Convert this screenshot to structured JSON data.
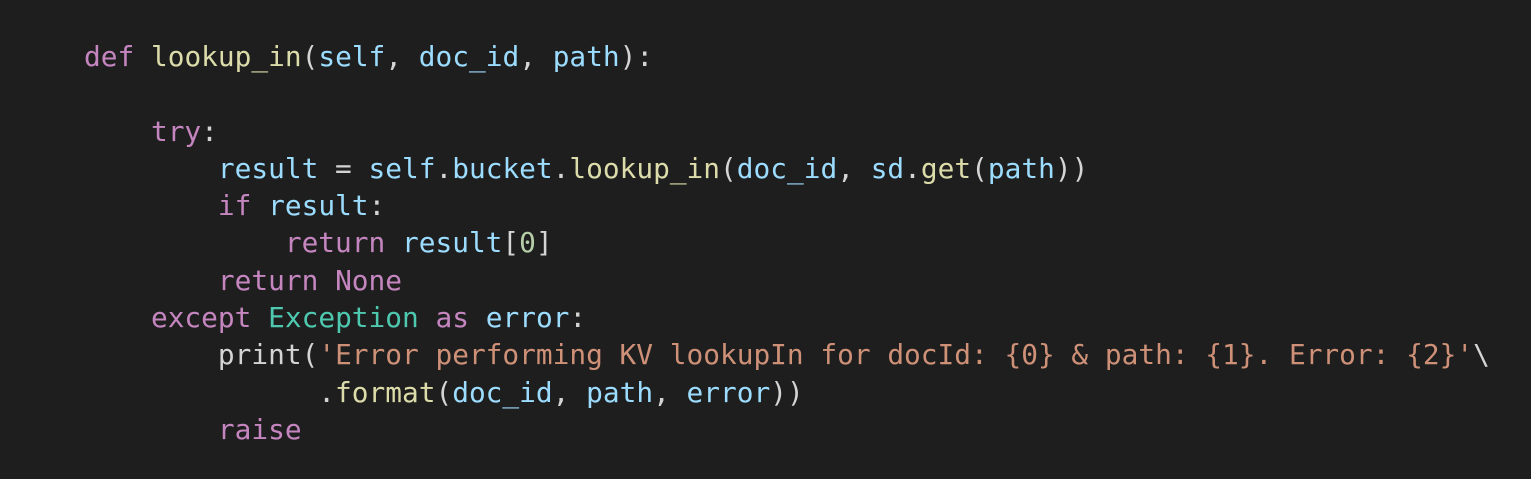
{
  "colors": {
    "background": "#1e1e1e",
    "keyword": "#c586c0",
    "function": "#dcdcaa",
    "variable": "#9cdcfe",
    "class": "#4ec9b0",
    "string": "#ce9178",
    "number": "#b5cea8",
    "plain": "#d4d4d4"
  },
  "code": {
    "language": "python",
    "lines": [
      [
        [
          "keyword",
          "def"
        ],
        [
          "plain",
          " "
        ],
        [
          "function",
          "lookup_in"
        ],
        [
          "plain",
          "("
        ],
        [
          "variable",
          "self"
        ],
        [
          "plain",
          ", "
        ],
        [
          "variable",
          "doc_id"
        ],
        [
          "plain",
          ", "
        ],
        [
          "variable",
          "path"
        ],
        [
          "plain",
          "):"
        ]
      ],
      [],
      [
        [
          "plain",
          "    "
        ],
        [
          "keyword",
          "try"
        ],
        [
          "plain",
          ":"
        ]
      ],
      [
        [
          "plain",
          "        "
        ],
        [
          "variable",
          "result"
        ],
        [
          "plain",
          " = "
        ],
        [
          "variable",
          "self"
        ],
        [
          "plain",
          "."
        ],
        [
          "variable",
          "bucket"
        ],
        [
          "plain",
          "."
        ],
        [
          "function",
          "lookup_in"
        ],
        [
          "plain",
          "("
        ],
        [
          "variable",
          "doc_id"
        ],
        [
          "plain",
          ", "
        ],
        [
          "variable",
          "sd"
        ],
        [
          "plain",
          "."
        ],
        [
          "function",
          "get"
        ],
        [
          "plain",
          "("
        ],
        [
          "variable",
          "path"
        ],
        [
          "plain",
          "))"
        ]
      ],
      [
        [
          "plain",
          "        "
        ],
        [
          "keyword",
          "if"
        ],
        [
          "plain",
          " "
        ],
        [
          "variable",
          "result"
        ],
        [
          "plain",
          ":"
        ]
      ],
      [
        [
          "plain",
          "            "
        ],
        [
          "keyword",
          "return"
        ],
        [
          "plain",
          " "
        ],
        [
          "variable",
          "result"
        ],
        [
          "plain",
          "["
        ],
        [
          "number",
          "0"
        ],
        [
          "plain",
          "]"
        ]
      ],
      [
        [
          "plain",
          "        "
        ],
        [
          "keyword",
          "return"
        ],
        [
          "plain",
          " "
        ],
        [
          "keyword",
          "None"
        ]
      ],
      [
        [
          "plain",
          "    "
        ],
        [
          "keyword",
          "except"
        ],
        [
          "plain",
          " "
        ],
        [
          "class",
          "Exception"
        ],
        [
          "plain",
          " "
        ],
        [
          "keyword",
          "as"
        ],
        [
          "plain",
          " "
        ],
        [
          "variable",
          "error"
        ],
        [
          "plain",
          ":"
        ]
      ],
      [
        [
          "plain",
          "        "
        ],
        [
          "plain",
          "print"
        ],
        [
          "plain",
          "("
        ],
        [
          "string",
          "'Error performing KV lookupIn for docId: {0} & path: {1}. Error: {2}'"
        ],
        [
          "plain",
          "\\"
        ]
      ],
      [
        [
          "plain",
          "              ."
        ],
        [
          "function",
          "format"
        ],
        [
          "plain",
          "("
        ],
        [
          "variable",
          "doc_id"
        ],
        [
          "plain",
          ", "
        ],
        [
          "variable",
          "path"
        ],
        [
          "plain",
          ", "
        ],
        [
          "variable",
          "error"
        ],
        [
          "plain",
          "))"
        ]
      ],
      [
        [
          "plain",
          "        "
        ],
        [
          "keyword",
          "raise"
        ]
      ]
    ]
  }
}
